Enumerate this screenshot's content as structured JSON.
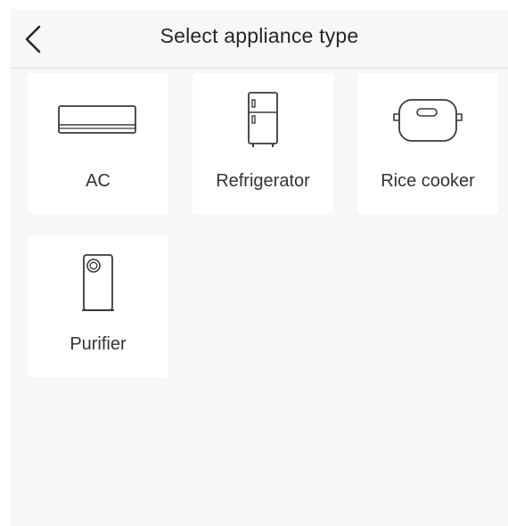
{
  "header": {
    "title": "Select appliance type",
    "back_icon": "chevron-left-icon"
  },
  "appliances": [
    {
      "label": "AC",
      "icon": "air-conditioner-icon"
    },
    {
      "label": "Refrigerator",
      "icon": "refrigerator-icon"
    },
    {
      "label": "Rice cooker",
      "icon": "rice-cooker-icon"
    },
    {
      "label": "Purifier",
      "icon": "air-purifier-icon"
    }
  ],
  "colors": {
    "background": "#f7f7f7",
    "tile": "#ffffff",
    "text": "#333333",
    "icon_stroke": "#3a3a3a"
  }
}
